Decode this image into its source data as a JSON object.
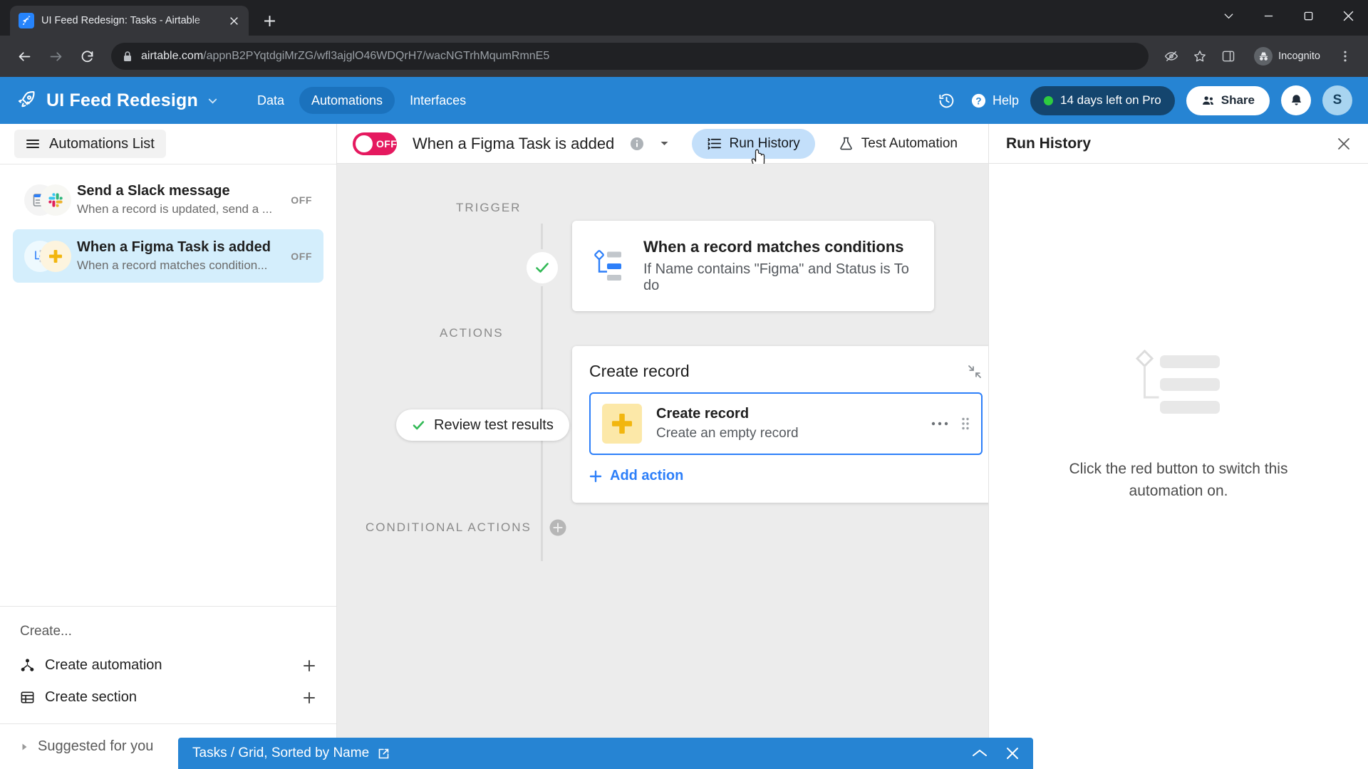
{
  "browser": {
    "tab": {
      "title": "UI Feed Redesign: Tasks - Airtable",
      "favicon": "airtable-rocket-icon"
    },
    "new_tab_label": "+",
    "url_domain": "airtable.com",
    "url_path": "/appnB2PYqtdgiMrZG/wfl3ajglO46WDQrH7/wacNGTrhMqumRmnE5",
    "profile_label": "Incognito",
    "window_controls": [
      "minimize-all",
      "minimize",
      "maximize",
      "close"
    ]
  },
  "appbar": {
    "logo": "rocket-logo-icon",
    "base_name": "UI Feed Redesign",
    "tabs": [
      {
        "label": "Data",
        "active": false
      },
      {
        "label": "Automations",
        "active": true
      },
      {
        "label": "Interfaces",
        "active": false
      }
    ],
    "history_icon": "history-clock-icon",
    "help_label": "Help",
    "trial_label": "14 days left on Pro",
    "share_label": "Share",
    "notification_icon": "bell-icon",
    "avatar_initial": "S",
    "accent_color": "#2684d3",
    "trial_pill_color": "#14456e",
    "status_dot_color": "#2ecc40"
  },
  "sidebar": {
    "header_label": "Automations List",
    "automations": [
      {
        "title": "Send a Slack message",
        "description": "When a record is updated, send a ...",
        "status": "OFF",
        "selected": false,
        "icons": [
          "record-window-icon",
          "slack-icon"
        ]
      },
      {
        "title": "When a Figma Task is added",
        "description": "When a record matches condition...",
        "status": "OFF",
        "selected": true,
        "icons": [
          "record-match-icon",
          "plus-square-icon"
        ]
      }
    ],
    "create_label": "Create...",
    "create_items": [
      {
        "label": "Create automation",
        "icon": "automation-node-icon",
        "action": "add-icon"
      },
      {
        "label": "Create section",
        "icon": "grid-table-icon",
        "action": "add-icon"
      }
    ],
    "suggested_label": "Suggested for you",
    "suggested_expanded": false
  },
  "editor": {
    "toggle_state": "OFF",
    "toggle_color": "#e5195f",
    "automation_name": "When a Figma Task is added",
    "info_icon": "info-icon",
    "caret_icon": "chevron-down-icon",
    "buttons": [
      {
        "label": "Run History",
        "icon": "list-lines-icon",
        "active": true
      },
      {
        "label": "Test Automation",
        "icon": "flask-icon",
        "active": false
      }
    ],
    "trigger_section_label": "TRIGGER",
    "actions_section_label": "ACTIONS",
    "conditional_section_label": "CONDITIONAL ACTIONS",
    "trigger": {
      "title": "When a record matches conditions",
      "description": "If Name contains \"Figma\" and Status is To do",
      "icon": "record-match-icon",
      "state": "checked"
    },
    "action_group": {
      "title": "Create record",
      "expand_icon": "collapse-arrows-icon",
      "action": {
        "title": "Create record",
        "description": "Create an empty record",
        "icon": "plus-square-icon",
        "icon_bg": "#fce8a8",
        "selected_border": "#2d7ff9",
        "more_icon": "ellipsis-icon",
        "drag_icon": "drag-handle-icon"
      },
      "add_action_label": "Add action"
    },
    "review_pill_label": "Review test results",
    "review_pill_icon": "check-icon"
  },
  "run_history": {
    "title": "Run History",
    "close_icon": "close-icon",
    "empty_illustration": "run-history-placeholder-icon",
    "empty_message": "Click the red button to switch this automation on."
  },
  "bottom_bar": {
    "label": "Tasks / Grid, Sorted by Name",
    "external_icon": "external-link-icon",
    "collapse_icon": "chevron-up-icon",
    "close_icon": "close-icon",
    "color": "#2684d3"
  }
}
